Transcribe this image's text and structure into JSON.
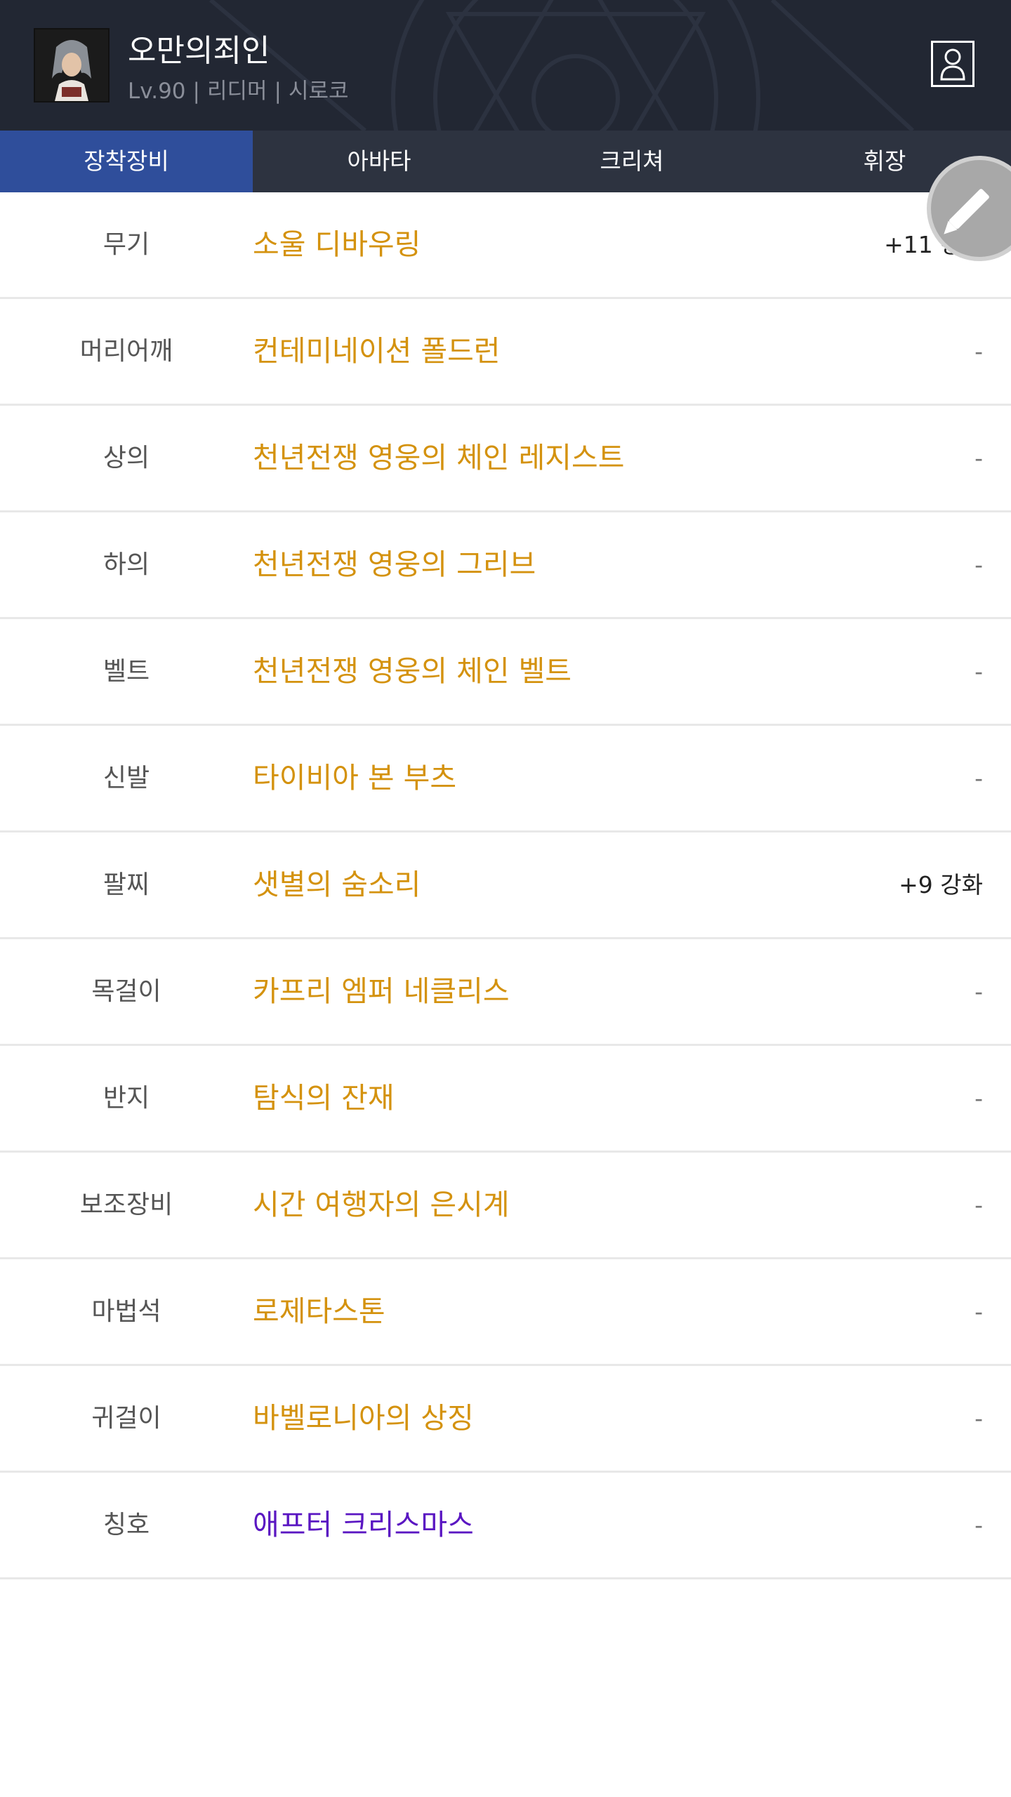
{
  "character": {
    "name": "오만의죄인",
    "level": "Lv.90",
    "class": "리디머",
    "server": "시로코"
  },
  "tabs": [
    {
      "label": "장착장비",
      "active": true
    },
    {
      "label": "아바타",
      "active": false
    },
    {
      "label": "크리쳐",
      "active": false
    },
    {
      "label": "휘장",
      "active": false
    }
  ],
  "equipment": [
    {
      "slot": "무기",
      "item": "소울 디바우링",
      "enhance": "+11 강화"
    },
    {
      "slot": "머리어깨",
      "item": "컨테미네이션 폴드런",
      "enhance": "-"
    },
    {
      "slot": "상의",
      "item": "천년전쟁 영웅의 체인 레지스트",
      "enhance": "-"
    },
    {
      "slot": "하의",
      "item": "천년전쟁 영웅의 그리브",
      "enhance": "-"
    },
    {
      "slot": "벨트",
      "item": "천년전쟁 영웅의 체인 벨트",
      "enhance": "-"
    },
    {
      "slot": "신발",
      "item": "타이비아 본 부츠",
      "enhance": "-"
    },
    {
      "slot": "팔찌",
      "item": "샛별의 숨소리",
      "enhance": "+9 강화"
    },
    {
      "slot": "목걸이",
      "item": "카프리 엠퍼 네클리스",
      "enhance": "-"
    },
    {
      "slot": "반지",
      "item": "탐식의 잔재",
      "enhance": "-"
    },
    {
      "slot": "보조장비",
      "item": "시간 여행자의 은시계",
      "enhance": "-"
    },
    {
      "slot": "마법석",
      "item": "로제타스톤",
      "enhance": "-"
    },
    {
      "slot": "귀걸이",
      "item": "바벨로니아의 상징",
      "enhance": "-"
    },
    {
      "slot": "칭호",
      "item": "애프터 크리스마스",
      "enhance": "-"
    }
  ],
  "colors": {
    "header_bg": "#222733",
    "tab_bg": "#2d3340",
    "tab_active": "#2f4e9b",
    "item_legendary": "#d4920e",
    "item_epic": "#5a16c2"
  },
  "icons": {
    "profile": "person-icon",
    "edit": "pencil-icon"
  }
}
